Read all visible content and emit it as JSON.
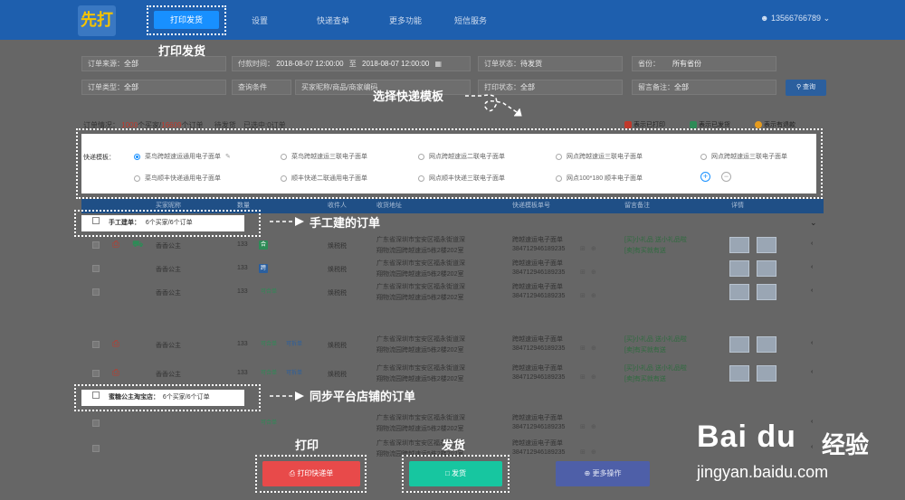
{
  "nav": {
    "logo": "先打",
    "print_ship": "打印发货",
    "settings": "设置",
    "quick_check": "快递查单",
    "more_features": "更多功能",
    "sms": "短信服务",
    "user": "13566766789"
  },
  "filters": {
    "order_source_label": "订单来源：",
    "order_source_value": "全部",
    "pay_time_label": "付款时间：",
    "pay_time_from": "2018-08-07 12:00:00",
    "pay_time_to_sep": "至",
    "pay_time_to": "2018-08-07 12:00:00",
    "order_status_label": "订单状态：",
    "order_status_value": "待发货",
    "province_label": "省份：",
    "province_value": "所有省份",
    "order_type_label": "订单类型：",
    "order_type_value": "全部",
    "query_cond_label": "查询条件",
    "query_cond_placeholder": "买家昵称/商品/商家编码",
    "print_status_label": "打印状态：",
    "print_status_value": "全部",
    "remark_label": "留言备注：",
    "remark_value": "全部",
    "query_button": "查询"
  },
  "summary": {
    "label": "订单情况：",
    "buyers": "1000",
    "buyers_suffix": "个买家/",
    "orders": "16609",
    "orders_suffix": "个订单",
    "pending": "待发货",
    "selected": "已选中:0订单"
  },
  "legend": {
    "printed": "表示已打印",
    "shipped": "表示已发货",
    "refund": "表示有退款"
  },
  "template_panel": {
    "label": "快递模板：",
    "options": [
      "菜鸟跨越速运通用电子面单",
      "菜鸟跨越速运三联电子面单",
      "网点跨越速运二联电子面单",
      "网点跨越速运三联电子面单",
      "网点跨越速运三联电子面单",
      "菜鸟顺丰快递通用电子面单",
      "顺丰快递二联通用电子面单",
      "网点顺丰快递三联电子面单",
      "网点100*180 顺丰电子面单"
    ]
  },
  "table": {
    "headers": [
      "买家昵称",
      "数量",
      "收件人",
      "收货地址",
      "快递模板单号",
      "留言备注",
      "详情"
    ],
    "group1": {
      "name": "手工建单：",
      "count": "6个买家/6个订单"
    },
    "group2": {
      "name": "蜜糖公主淘宝店：",
      "count": "6个买家/6个订单"
    },
    "rows": [
      {
        "buyer": "香香公主",
        "qty": "133",
        "tags": [
          "合"
        ],
        "recipient": "焕税税",
        "addr1": "广东省深圳市宝安区福永街道深",
        "addr2": "翔物流园跨越速运5栋2楼202室",
        "tpl": "跨越速运电子面单",
        "no": "38471294618923​5",
        "remark1": "[买]小礼品 送小礼品啦",
        "remark2": "[卖]有买就有送"
      },
      {
        "buyer": "香香公主",
        "qty": "133",
        "tags": [
          "跨"
        ],
        "recipient": "焕税税",
        "addr1": "广东省深圳市宝安区福永街道深",
        "addr2": "翔物流园跨越速运5栋2楼202室",
        "tpl": "跨越速运电子面单",
        "no": "384712946189235",
        "remark1": "",
        "remark2": ""
      },
      {
        "buyer": "香香公主",
        "qty": "133",
        "tags": [
          "可合单"
        ],
        "recipient": "焕税税",
        "addr1": "广东省深圳市宝安区福永街道深",
        "addr2": "翔物流园跨越速运5栋2楼202室",
        "tpl": "跨越速运电子面单",
        "no": "384712946189235",
        "remark1": "",
        "remark2": ""
      },
      {
        "buyer": "香香公主",
        "qty": "133",
        "tags": [
          "可合单",
          "可拆单"
        ],
        "recipient": "焕税税",
        "addr1": "广东省深圳市宝安区福永街道深",
        "addr2": "翔物流园跨越速运5栋2楼202室",
        "tpl": "跨越速运电子面单",
        "no": "384712946189235",
        "remark1": "[买]小礼品 送小礼品啦",
        "remark2": "[卖]有买就有送"
      },
      {
        "buyer": "香香公主",
        "qty": "133",
        "tags": [
          "可合单",
          "可拆单"
        ],
        "recipient": "焕税税",
        "addr1": "广东省深圳市宝安区福永街道深",
        "addr2": "翔物流园跨越速运5栋2楼202室",
        "tpl": "跨越速运电子面单",
        "no": "384712946189235",
        "remark1": "[买]小礼品 送小礼品啦",
        "remark2": "[卖]有买就有送"
      },
      {
        "buyer": "",
        "qty": "",
        "tags": [
          "可合单"
        ],
        "recipient": "",
        "addr1": "广东省深圳市宝安区福永街道深",
        "addr2": "翔物流园跨越速运5栋2楼202室",
        "tpl": "跨越速运电子面单",
        "no": "384712946189235",
        "remark1": "",
        "remark2": ""
      },
      {
        "buyer": "",
        "qty": "",
        "tags": [],
        "recipient": "",
        "addr1": "广东省深圳市宝安区福永街道深",
        "addr2": "翔物流园跨越速运5栋2楼202室",
        "tpl": "跨越速运电子面单",
        "no": "384712946189235",
        "remark1": "",
        "remark2": ""
      }
    ]
  },
  "annotations": {
    "print_ship": "打印发货",
    "select_template": "选择快递模板",
    "manual_orders": "手工建的订单",
    "synced_orders": "同步平台店铺的订单",
    "print": "打印",
    "ship": "发货"
  },
  "buttons": {
    "print": "打印快递单",
    "ship": "发货",
    "more": "更多操作"
  },
  "watermark": {
    "logo": "Bai du",
    "cn": "经验",
    "url": "jingyan.baidu.com"
  }
}
